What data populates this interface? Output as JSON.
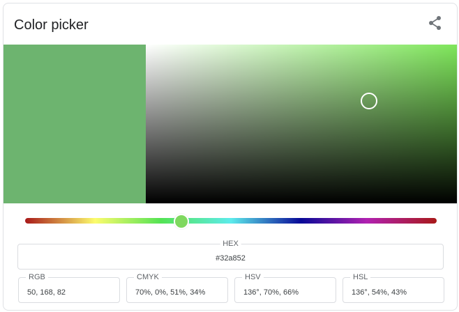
{
  "header": {
    "title": "Color picker",
    "share_icon": "share-icon"
  },
  "colors": {
    "selected": "#6db46f",
    "hue": "#7ee65a",
    "hue_handle": "#7fd85f"
  },
  "fields": {
    "hex": {
      "label": "HEX",
      "value": "#32a852"
    },
    "rgb": {
      "label": "RGB",
      "value": "50, 168, 82"
    },
    "cmyk": {
      "label": "CMYK",
      "value": "70%, 0%, 51%, 34%"
    },
    "hsv": {
      "label": "HSV",
      "value": "136°, 70%, 66%"
    },
    "hsl": {
      "label": "HSL",
      "value": "136°, 54%, 43%"
    }
  }
}
